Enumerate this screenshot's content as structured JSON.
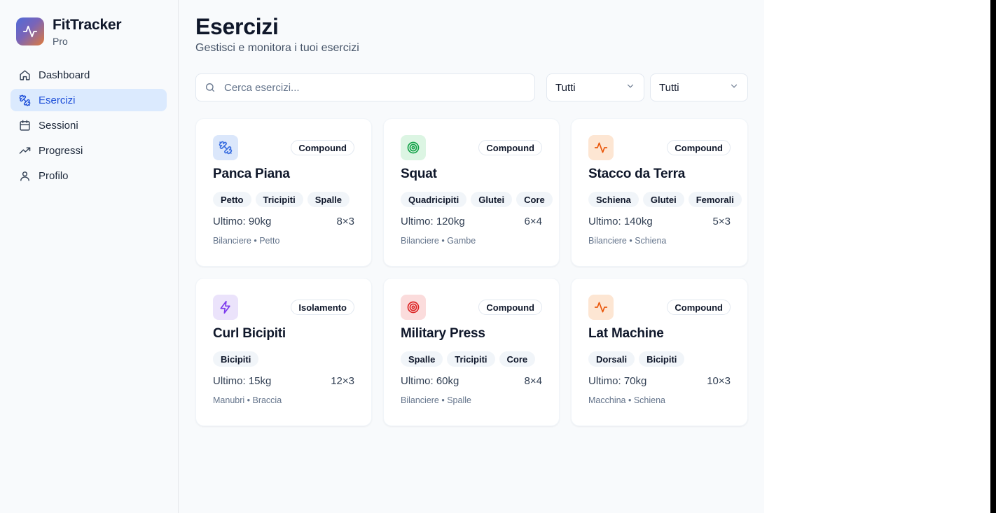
{
  "brand": {
    "title": "FitTracker",
    "subtitle": "Pro"
  },
  "nav": [
    {
      "label": "Dashboard",
      "icon": "home-icon",
      "active": false
    },
    {
      "label": "Esercizi",
      "icon": "dumbbell-icon",
      "active": true
    },
    {
      "label": "Sessioni",
      "icon": "calendar-icon",
      "active": false
    },
    {
      "label": "Progressi",
      "icon": "trending-up-icon",
      "active": false
    },
    {
      "label": "Profilo",
      "icon": "user-icon",
      "active": false
    }
  ],
  "page": {
    "title": "Esercizi",
    "subtitle": "Gestisci e monitora i tuoi esercizi"
  },
  "search": {
    "placeholder": "Cerca esercizi...",
    "value": ""
  },
  "filters": [
    {
      "value": "Tutti"
    },
    {
      "value": "Tutti"
    }
  ],
  "colors": {
    "accent": "#1d4ed8",
    "active_bg": "#dbeafe"
  },
  "exercises": [
    {
      "name": "Panca Piana",
      "type": "Compound",
      "icon": "dumbbell-icon",
      "icon_color": "#3b6fe0",
      "icon_bg": "#dbe7fb",
      "tags": [
        "Petto",
        "Tricipiti",
        "Spalle"
      ],
      "last": "Ultimo: 90kg",
      "sets": "8×3",
      "meta": "Bilanciere • Petto"
    },
    {
      "name": "Squat",
      "type": "Compound",
      "icon": "target-icon",
      "icon_color": "#16a34a",
      "icon_bg": "#dcf5e3",
      "tags": [
        "Quadricipiti",
        "Glutei",
        "Core"
      ],
      "last": "Ultimo: 120kg",
      "sets": "6×4",
      "meta": "Bilanciere • Gambe"
    },
    {
      "name": "Stacco da Terra",
      "type": "Compound",
      "icon": "activity-icon",
      "icon_color": "#ea580c",
      "icon_bg": "#fde6d3",
      "tags": [
        "Schiena",
        "Glutei",
        "Femorali"
      ],
      "last": "Ultimo: 140kg",
      "sets": "5×3",
      "meta": "Bilanciere • Schiena"
    },
    {
      "name": "Curl Bicipiti",
      "type": "Isolamento",
      "icon": "zap-icon",
      "icon_color": "#7c3aed",
      "icon_bg": "#ebe3fb",
      "tags": [
        "Bicipiti"
      ],
      "last": "Ultimo: 15kg",
      "sets": "12×3",
      "meta": "Manubri • Braccia"
    },
    {
      "name": "Military Press",
      "type": "Compound",
      "icon": "target-icon",
      "icon_color": "#dc2626",
      "icon_bg": "#fbdcdc",
      "tags": [
        "Spalle",
        "Tricipiti",
        "Core"
      ],
      "last": "Ultimo: 60kg",
      "sets": "8×4",
      "meta": "Bilanciere • Spalle"
    },
    {
      "name": "Lat Machine",
      "type": "Compound",
      "icon": "activity-icon",
      "icon_color": "#ea580c",
      "icon_bg": "#fde6d3",
      "tags": [
        "Dorsali",
        "Bicipiti"
      ],
      "last": "Ultimo: 70kg",
      "sets": "10×3",
      "meta": "Macchina • Schiena"
    }
  ]
}
